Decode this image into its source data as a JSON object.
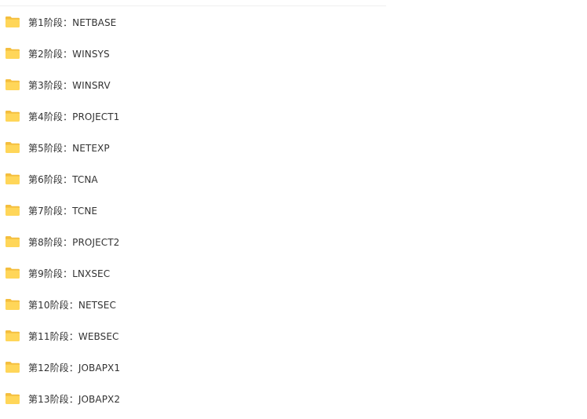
{
  "colors": {
    "folder_fill": "#FFD659",
    "folder_tab": "#F4BE3E",
    "text": "#333333"
  },
  "folders": [
    {
      "label": "第1阶段：NETBASE",
      "icon": "folder-icon"
    },
    {
      "label": "第2阶段：WINSYS",
      "icon": "folder-icon"
    },
    {
      "label": "第3阶段：WINSRV",
      "icon": "folder-icon"
    },
    {
      "label": "第4阶段：PROJECT1",
      "icon": "folder-icon"
    },
    {
      "label": "第5阶段：NETEXP",
      "icon": "folder-icon"
    },
    {
      "label": "第6阶段：TCNA",
      "icon": "folder-icon"
    },
    {
      "label": "第7阶段：TCNE",
      "icon": "folder-icon"
    },
    {
      "label": "第8阶段：PROJECT2",
      "icon": "folder-icon"
    },
    {
      "label": "第9阶段：LNXSEC",
      "icon": "folder-icon"
    },
    {
      "label": "第10阶段：NETSEC",
      "icon": "folder-icon"
    },
    {
      "label": "第11阶段：WEBSEC",
      "icon": "folder-icon"
    },
    {
      "label": "第12阶段：JOBAPX1",
      "icon": "folder-icon"
    },
    {
      "label": "第13阶段：JOBAPX2",
      "icon": "folder-icon"
    }
  ]
}
